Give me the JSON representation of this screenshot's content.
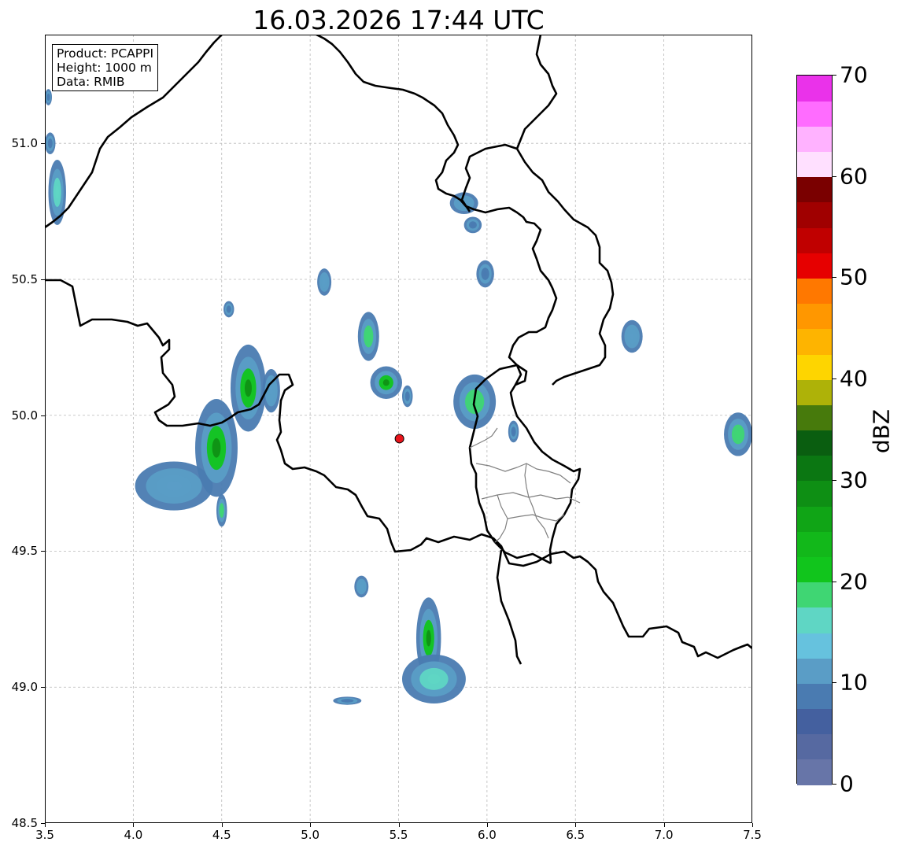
{
  "title": "16.03.2026 17:44 UTC",
  "info": {
    "product": "Product: PCAPPI",
    "height": "Height: 1000 m",
    "data": "Data: RMIB"
  },
  "axes": {
    "x_ticks": [
      "3.5",
      "4.0",
      "4.5",
      "5.0",
      "5.5",
      "6.0",
      "6.5",
      "7.0",
      "7.5"
    ],
    "y_ticks": [
      "48.5",
      "49.0",
      "49.5",
      "50.0",
      "50.5",
      "51.0"
    ],
    "lon_range": [
      3.5,
      7.5
    ],
    "lat_range": [
      48.5,
      51.4
    ],
    "grid": true
  },
  "colorbar": {
    "unit": "dBZ",
    "labels": [
      "0",
      "10",
      "20",
      "30",
      "40",
      "50",
      "60",
      "70"
    ],
    "range": [
      0,
      70
    ],
    "step": 2.5,
    "colors": [
      "#6775a8",
      "#5669a1",
      "#44609f",
      "#4a7bb1",
      "#5a9dc6",
      "#66c2de",
      "#5fd6c4",
      "#3fd673",
      "#11c51c",
      "#12b81a",
      "#10a516",
      "#0e8f14",
      "#0b7712",
      "#0a5e10",
      "#477a0c",
      "#aeb208",
      "#fed500",
      "#feb400",
      "#ff9700",
      "#ff7800",
      "#e60000",
      "#c00000",
      "#a00000",
      "#7a0000",
      "#ffe0ff",
      "#ffb2ff",
      "#ff6cff",
      "#ea32ea"
    ]
  },
  "radar_site": {
    "lon": 5.505,
    "lat": 49.914,
    "color": "#e8141b"
  },
  "echoes": [
    {
      "lon": 3.57,
      "lat": 50.82,
      "rx": 0.05,
      "ry": 0.12,
      "core": "#5fd6c4"
    },
    {
      "lon": 3.53,
      "lat": 51.0,
      "rx": 0.03,
      "ry": 0.04,
      "core": "#4a7bb1"
    },
    {
      "lon": 3.52,
      "lat": 51.17,
      "rx": 0.02,
      "ry": 0.03,
      "core": "#4a7bb1"
    },
    {
      "lon": 4.23,
      "lat": 49.74,
      "rx": 0.22,
      "ry": 0.09,
      "core": "#5a9dc6"
    },
    {
      "lon": 4.47,
      "lat": 49.88,
      "rx": 0.12,
      "ry": 0.18,
      "core": "#11c51c"
    },
    {
      "lon": 4.65,
      "lat": 50.1,
      "rx": 0.1,
      "ry": 0.16,
      "core": "#11c51c"
    },
    {
      "lon": 4.78,
      "lat": 50.09,
      "rx": 0.05,
      "ry": 0.08,
      "core": "#5a9dc6"
    },
    {
      "lon": 4.5,
      "lat": 49.65,
      "rx": 0.03,
      "ry": 0.06,
      "core": "#3fd673"
    },
    {
      "lon": 4.54,
      "lat": 50.39,
      "rx": 0.03,
      "ry": 0.03,
      "core": "#4a7bb1"
    },
    {
      "lon": 5.08,
      "lat": 50.49,
      "rx": 0.04,
      "ry": 0.05,
      "core": "#5a9dc6"
    },
    {
      "lon": 5.33,
      "lat": 50.29,
      "rx": 0.06,
      "ry": 0.09,
      "core": "#3fd673"
    },
    {
      "lon": 5.43,
      "lat": 50.12,
      "rx": 0.09,
      "ry": 0.06,
      "core": "#11c51c"
    },
    {
      "lon": 5.55,
      "lat": 50.07,
      "rx": 0.03,
      "ry": 0.04,
      "core": "#4a7bb1"
    },
    {
      "lon": 5.87,
      "lat": 50.78,
      "rx": 0.08,
      "ry": 0.04,
      "core": "#5a9dc6"
    },
    {
      "lon": 5.92,
      "lat": 50.7,
      "rx": 0.05,
      "ry": 0.03,
      "core": "#4a7bb1"
    },
    {
      "lon": 5.99,
      "lat": 50.52,
      "rx": 0.05,
      "ry": 0.05,
      "core": "#4a7bb1"
    },
    {
      "lon": 5.93,
      "lat": 50.05,
      "rx": 0.12,
      "ry": 0.1,
      "core": "#3fd673"
    },
    {
      "lon": 6.15,
      "lat": 49.94,
      "rx": 0.03,
      "ry": 0.04,
      "core": "#4a7bb1"
    },
    {
      "lon": 6.82,
      "lat": 50.29,
      "rx": 0.06,
      "ry": 0.06,
      "core": "#5a9dc6"
    },
    {
      "lon": 7.42,
      "lat": 49.93,
      "rx": 0.08,
      "ry": 0.08,
      "core": "#3fd673"
    },
    {
      "lon": 5.29,
      "lat": 49.37,
      "rx": 0.04,
      "ry": 0.04,
      "core": "#5a9dc6"
    },
    {
      "lon": 5.67,
      "lat": 49.18,
      "rx": 0.07,
      "ry": 0.15,
      "core": "#11c51c"
    },
    {
      "lon": 5.7,
      "lat": 49.03,
      "rx": 0.18,
      "ry": 0.09,
      "core": "#5fd6c4"
    },
    {
      "lon": 5.21,
      "lat": 48.95,
      "rx": 0.08,
      "ry": 0.015,
      "core": "#4a7bb1"
    }
  ]
}
